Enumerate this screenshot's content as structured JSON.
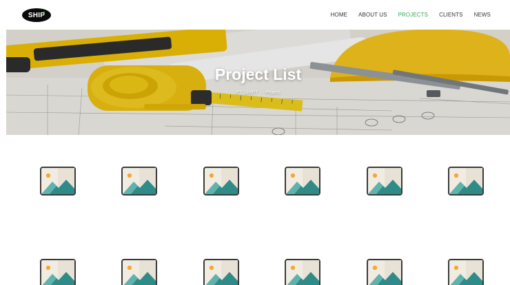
{
  "header": {
    "logo_text": "SHIP",
    "nav": [
      {
        "label": "HOME",
        "active": false
      },
      {
        "label": "ABOUT US",
        "active": false
      },
      {
        "label": "PROJECTS",
        "active": true
      },
      {
        "label": "CLIENTS",
        "active": false
      },
      {
        "label": "NEWS",
        "active": false
      }
    ]
  },
  "hero": {
    "title": "Project List",
    "breadcrumb": {
      "home": "PT. SHIPT",
      "current": "Project"
    }
  },
  "projects": {
    "row1": [
      "image-placeholder-icon",
      "image-placeholder-icon",
      "image-placeholder-icon",
      "image-placeholder-icon",
      "image-placeholder-icon",
      "image-placeholder-icon"
    ],
    "row2": [
      "image-placeholder-icon",
      "image-placeholder-icon",
      "image-placeholder-icon",
      "image-placeholder-icon",
      "image-placeholder-icon",
      "image-placeholder-icon"
    ]
  },
  "colors": {
    "accent": "#3aa65a",
    "placeholder_teal": "#2e8b87",
    "placeholder_sun": "#f2a93b"
  }
}
